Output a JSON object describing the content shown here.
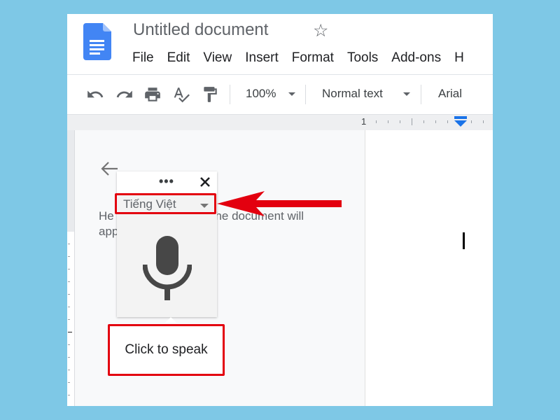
{
  "app": {
    "doc_title": "Untitled document",
    "icons": {
      "logo": "google-docs-icon",
      "star": "star-icon"
    }
  },
  "menu": [
    "File",
    "Edit",
    "View",
    "Insert",
    "Format",
    "Tools",
    "Add-ons",
    "H"
  ],
  "toolbar": {
    "icons": [
      "undo-icon",
      "redo-icon",
      "print-icon",
      "spellcheck-icon",
      "paint-format-icon"
    ],
    "zoom": "100%",
    "style": "Normal text",
    "font": "Arial"
  },
  "ruler": {
    "label": "1"
  },
  "voice_panel": {
    "helper_text_visible": "He",
    "helper_text_right": "the document will",
    "helper_text_line2": "app",
    "more_label": "•••",
    "language": "Tiếng Việt",
    "tooltip": "Click to speak"
  },
  "colors": {
    "annotation": "#e3000f",
    "background": "#7ec8e6",
    "docs_blue": "#4285f4"
  }
}
